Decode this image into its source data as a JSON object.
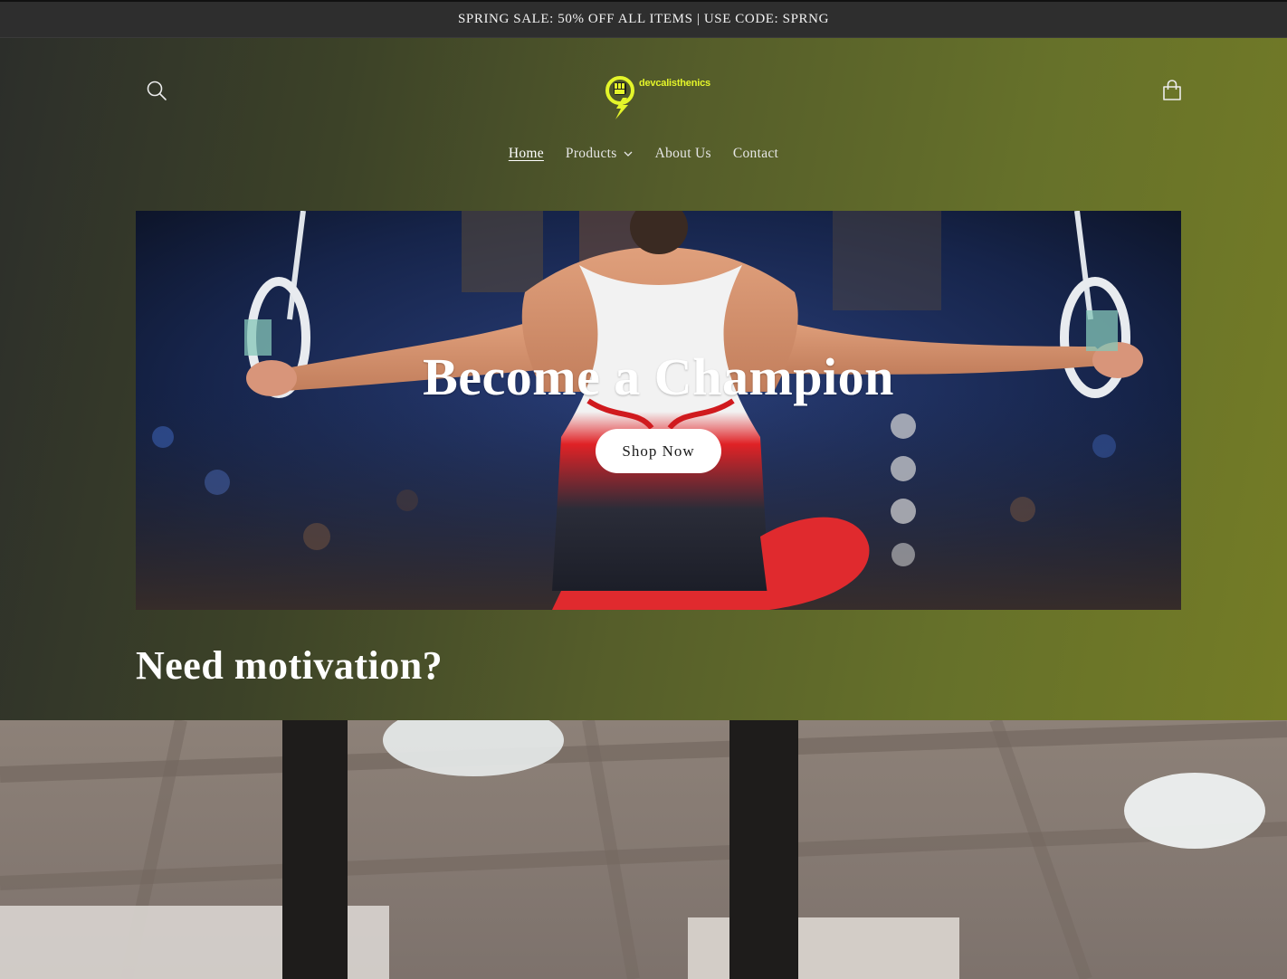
{
  "announcement": {
    "text": "SPRING SALE: 50% OFF ALL ITEMS | USE CODE: SPRNG"
  },
  "header": {
    "logo_text": "devcalisthenics",
    "search_icon": "search-icon",
    "cart_icon": "cart-icon"
  },
  "nav": {
    "items": [
      {
        "label": "Home",
        "active": true
      },
      {
        "label": "Products",
        "has_dropdown": true
      },
      {
        "label": "About Us"
      },
      {
        "label": "Contact"
      }
    ]
  },
  "hero": {
    "title": "Become a Champion",
    "button_label": "Shop Now"
  },
  "section": {
    "heading": "Need motivation?"
  },
  "colors": {
    "accent_logo": "#e4f52a",
    "announcement_bg": "#2e2e2e",
    "gradient_start": "#2c2e2a",
    "gradient_end": "#747c26"
  }
}
